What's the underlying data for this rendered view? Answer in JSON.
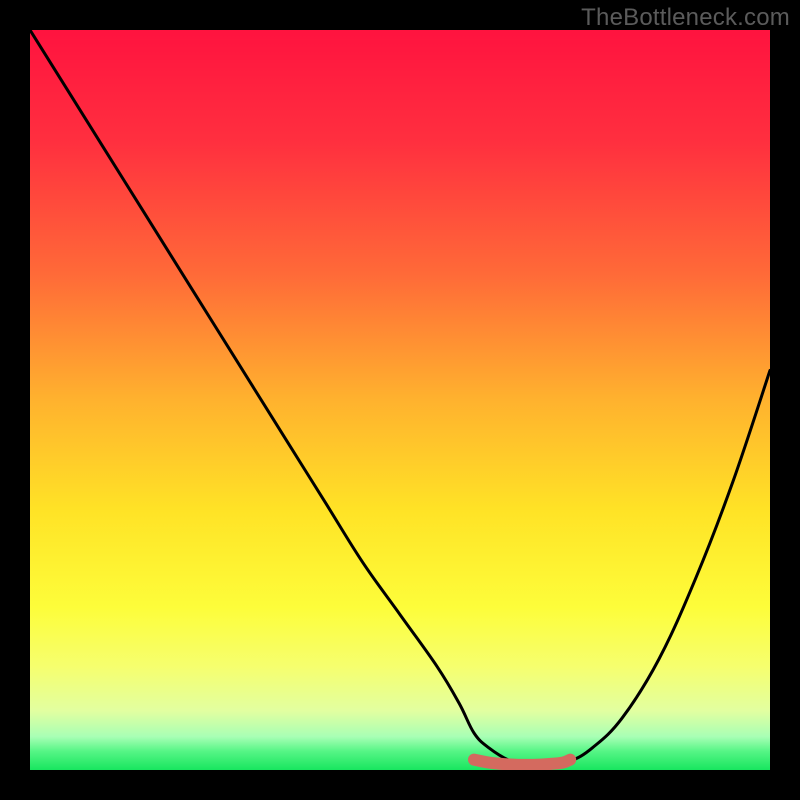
{
  "watermark": "TheBottleneck.com",
  "colors": {
    "frame": "#000000",
    "gradient_stops": [
      {
        "offset": 0.0,
        "color": "#ff133f"
      },
      {
        "offset": 0.15,
        "color": "#ff2f3f"
      },
      {
        "offset": 0.33,
        "color": "#ff6a38"
      },
      {
        "offset": 0.5,
        "color": "#ffb22e"
      },
      {
        "offset": 0.65,
        "color": "#ffe326"
      },
      {
        "offset": 0.78,
        "color": "#fdfd3a"
      },
      {
        "offset": 0.86,
        "color": "#f6ff6e"
      },
      {
        "offset": 0.92,
        "color": "#e2ffa0"
      },
      {
        "offset": 0.955,
        "color": "#a8ffb5"
      },
      {
        "offset": 0.975,
        "color": "#55f585"
      },
      {
        "offset": 1.0,
        "color": "#18e65f"
      }
    ],
    "curve": "#000000",
    "marker_fill": "#d46a5f",
    "marker_stroke": "#d46a5f"
  },
  "chart_data": {
    "type": "line",
    "title": "",
    "xlabel": "",
    "ylabel": "",
    "xlim": [
      0,
      100
    ],
    "ylim": [
      0,
      100
    ],
    "series": [
      {
        "name": "bottleneck-curve",
        "x": [
          0,
          5,
          10,
          15,
          20,
          25,
          30,
          35,
          40,
          45,
          50,
          55,
          58,
          60,
          62,
          65,
          68,
          70,
          73,
          76,
          80,
          85,
          90,
          95,
          100
        ],
        "y": [
          100,
          92,
          84,
          76,
          68,
          60,
          52,
          44,
          36,
          28,
          21,
          14,
          9,
          5,
          3,
          1.2,
          0.6,
          0.6,
          1.2,
          3,
          7,
          15,
          26,
          39,
          54
        ]
      }
    ],
    "marker": {
      "name": "optimal-range",
      "x": [
        60,
        62,
        64,
        66,
        68,
        70,
        72,
        73
      ],
      "y": [
        1.4,
        1.0,
        0.8,
        0.7,
        0.7,
        0.8,
        1.0,
        1.4
      ]
    }
  }
}
